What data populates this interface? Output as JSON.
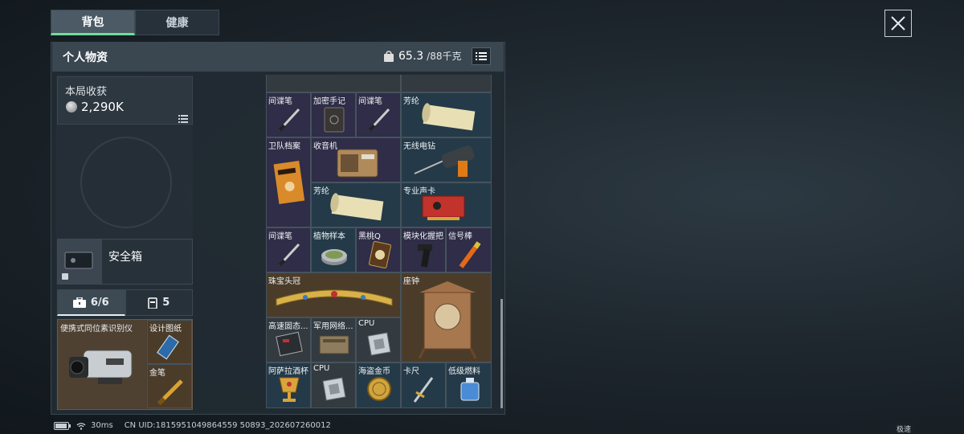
{
  "tabs": [
    {
      "label": "背包"
    },
    {
      "label": "健康"
    }
  ],
  "header": {
    "title": "个人物资",
    "weight_value": "65.3",
    "weight_max": "/88千克"
  },
  "harvest": {
    "label": "本局收获",
    "value": "2,290K"
  },
  "safe_box": {
    "label": "安全箱"
  },
  "sub_tabs": [
    {
      "label": "6/6"
    },
    {
      "label": "5"
    }
  ],
  "pocket": {
    "items": [
      {
        "label": "便携式同位素识别仪"
      },
      {
        "label": "设计图纸"
      },
      {
        "label": "金笔"
      }
    ]
  },
  "grid_items": [
    {
      "label": "间谍笔"
    },
    {
      "label": "加密手记"
    },
    {
      "label": "间谍笔"
    },
    {
      "label": "芳纶"
    },
    {
      "label": "卫队档案"
    },
    {
      "label": "收音机"
    },
    {
      "label": "无线电钻"
    },
    {
      "label": "芳纶"
    },
    {
      "label": "专业声卡"
    },
    {
      "label": "间谍笔"
    },
    {
      "label": "植物样本"
    },
    {
      "label": "黑桃Q"
    },
    {
      "label": "模块化握把"
    },
    {
      "label": "信号棒"
    },
    {
      "label": "珠宝头冠"
    },
    {
      "label": "座钟"
    },
    {
      "label": "高速固态..."
    },
    {
      "label": "军用网络..."
    },
    {
      "label": "CPU"
    },
    {
      "label": "阿萨拉酒杯"
    },
    {
      "label": "CPU"
    },
    {
      "label": "海盗金币"
    },
    {
      "label": "卡尺"
    },
    {
      "label": "低级燃料"
    }
  ],
  "status": {
    "ping": "30ms",
    "uid": "CN UID:1815951049864559 50893_202607260012",
    "speed_label": "极速"
  },
  "colors": {
    "accent": "#6fdc9c",
    "purple_rarity": "#2f2d47",
    "blue_rarity": "#243a48",
    "gold_rarity": "#4b3c2a"
  }
}
